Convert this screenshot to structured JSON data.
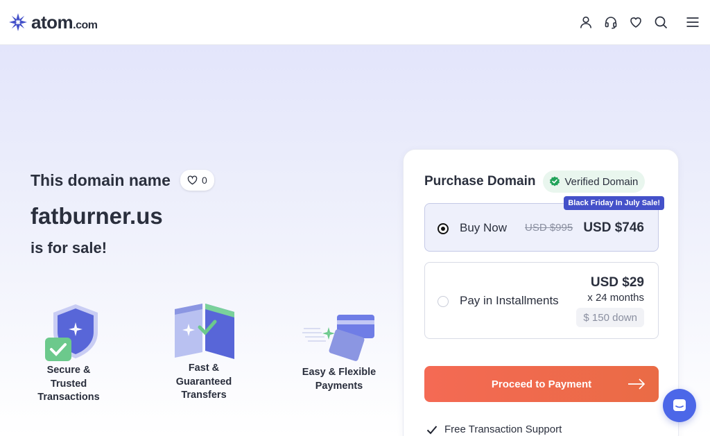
{
  "header": {
    "logo_main": "atom",
    "logo_suffix": ".com",
    "icons": [
      "user-icon",
      "headset-icon",
      "heart-icon",
      "search-icon",
      "menu-icon"
    ]
  },
  "hero": {
    "title_small": "This domain name",
    "like_count": "0",
    "domain": "fatburner.us",
    "for_sale": "is for sale!"
  },
  "features": [
    {
      "line1": "Secure &",
      "line2": "Trusted",
      "line3": "Transactions"
    },
    {
      "line1": "Fast &",
      "line2": "Guaranteed",
      "line3": "Transfers"
    },
    {
      "line1": "Easy & Flexible",
      "line2": "Payments",
      "line3": ""
    }
  ],
  "purchase": {
    "title": "Purchase Domain",
    "verified_label": "Verified Domain",
    "buy_now": {
      "label": "Buy Now",
      "promo": "Black Friday In July Sale!",
      "old_price": "USD $995",
      "price": "USD $746",
      "selected": true
    },
    "installments": {
      "label": "Pay in Installments",
      "price": "USD $29",
      "months": "x 24 months",
      "down": "$ 150 down",
      "selected": false
    },
    "proceed_label": "Proceed to Payment",
    "support_label": "Free Transaction Support"
  },
  "colors": {
    "accent": "#4451c9",
    "cta": "#f46a54",
    "verified_green": "#22a35a",
    "chat": "#4c67e8"
  }
}
